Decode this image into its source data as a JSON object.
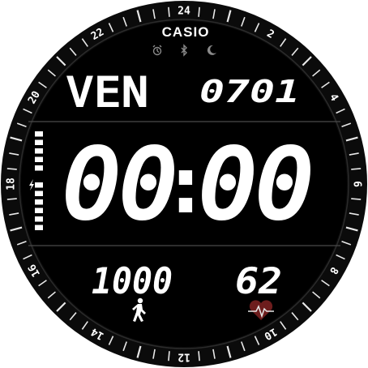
{
  "brand": "CASIO",
  "date": {
    "weekday": "VEN",
    "month_day": "0701"
  },
  "time": {
    "hours": "00",
    "separator": ":",
    "minutes": "00"
  },
  "steps": {
    "value": "1000",
    "icon": "walking-person-icon"
  },
  "heart_rate": {
    "value": "62",
    "icon": "heart-pulse-icon"
  },
  "status_icons": [
    "alarm-icon",
    "bluetooth-icon",
    "moon-icon"
  ],
  "battery": {
    "level": 1.0,
    "segments": 12,
    "icon": "lightning-bolt-icon"
  },
  "bezel_numbers": [
    "24",
    "2",
    "4",
    "6",
    "8",
    "10",
    "12",
    "14",
    "16",
    "18",
    "20",
    "22"
  ],
  "colors": {
    "face": "#000000",
    "bezel": "#111111",
    "text": "#ffffff",
    "muted_icon": "#8a8a8a",
    "divider": "#555555"
  }
}
